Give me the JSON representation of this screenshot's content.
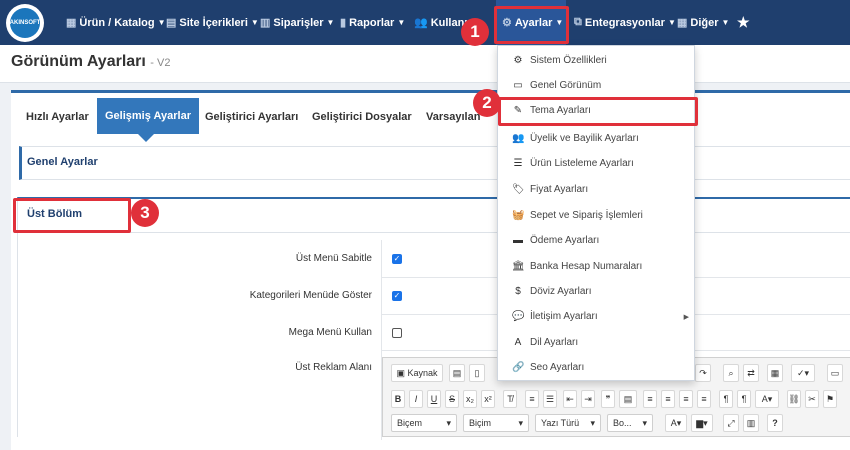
{
  "logo": {
    "text": "AKINSOFT"
  },
  "nav": {
    "items": [
      {
        "label": "Ürün / Katalog",
        "icon": "cubes-icon"
      },
      {
        "label": "Site İçerikleri",
        "icon": "layers-icon"
      },
      {
        "label": "Siparişler",
        "icon": "cart-icon"
      },
      {
        "label": "Raporlar",
        "icon": "chart-icon"
      },
      {
        "label": "Kullanı",
        "icon": "users-icon"
      },
      {
        "label": "Ayarlar",
        "icon": "cogs-icon"
      },
      {
        "label": "Entegrasyonlar",
        "icon": "sitemap-icon"
      },
      {
        "label": "Diğer",
        "icon": "grid-icon"
      }
    ],
    "star": "★"
  },
  "page": {
    "title": "Görünüm Ayarları",
    "subtitle": "- V2"
  },
  "tabs": [
    "Hızlı Ayarlar",
    "Gelişmiş Ayarlar",
    "Geliştirici Ayarları",
    "Geliştirici Dosyalar",
    "Varsayılan"
  ],
  "sections": {
    "general": "Genel Ayarlar",
    "top": "Üst Bölüm"
  },
  "form": {
    "fields": [
      {
        "label": "Üst Menü Sabitle",
        "checked": true
      },
      {
        "label": "Kategorileri Menüde Göster",
        "checked": true
      },
      {
        "label": "Mega Menü Kullan",
        "checked": false
      },
      {
        "label": "Üst Reklam Alanı"
      }
    ]
  },
  "editor": {
    "source": "Kaynak",
    "combos": [
      "Biçem",
      "Biçim",
      "Yazı Türü",
      "Bo..."
    ],
    "help": "?"
  },
  "dropdown": {
    "items": [
      {
        "label": "Sistem Özellikleri",
        "icon": "cogs-icon",
        "glyph": "⚙"
      },
      {
        "label": "Genel Görünüm",
        "icon": "monitor-icon",
        "glyph": "▭"
      },
      {
        "label": "Tema Ayarları",
        "icon": "brush-icon",
        "glyph": "✎"
      },
      {
        "label": "Üyelik ve Bayilik Ayarları",
        "icon": "users-icon",
        "glyph": "👥"
      },
      {
        "label": "Ürün Listeleme Ayarları",
        "icon": "list-icon",
        "glyph": "☰"
      },
      {
        "label": "Fiyat Ayarları",
        "icon": "tag-icon",
        "glyph": "🏷"
      },
      {
        "label": "Sepet ve Sipariş İşlemleri",
        "icon": "basket-icon",
        "glyph": "🧺"
      },
      {
        "label": "Ödeme Ayarları",
        "icon": "credit-card-icon",
        "glyph": "▬"
      },
      {
        "label": "Banka Hesap Numaraları",
        "icon": "bank-icon",
        "glyph": "🏛"
      },
      {
        "label": "Döviz Ayarları",
        "icon": "dollar-icon",
        "glyph": "$"
      },
      {
        "label": "İletişim Ayarları",
        "icon": "comments-icon",
        "glyph": "💬"
      },
      {
        "label": "Dil Ayarları",
        "icon": "language-icon",
        "glyph": "A"
      },
      {
        "label": "Seo Ayarları",
        "icon": "link-icon",
        "glyph": "🔗"
      }
    ]
  },
  "badges": [
    "1",
    "2",
    "3"
  ],
  "colors": {
    "nav_bg": "#1f3f6e",
    "accent": "#3377bb",
    "highlight": "#e0303a"
  }
}
